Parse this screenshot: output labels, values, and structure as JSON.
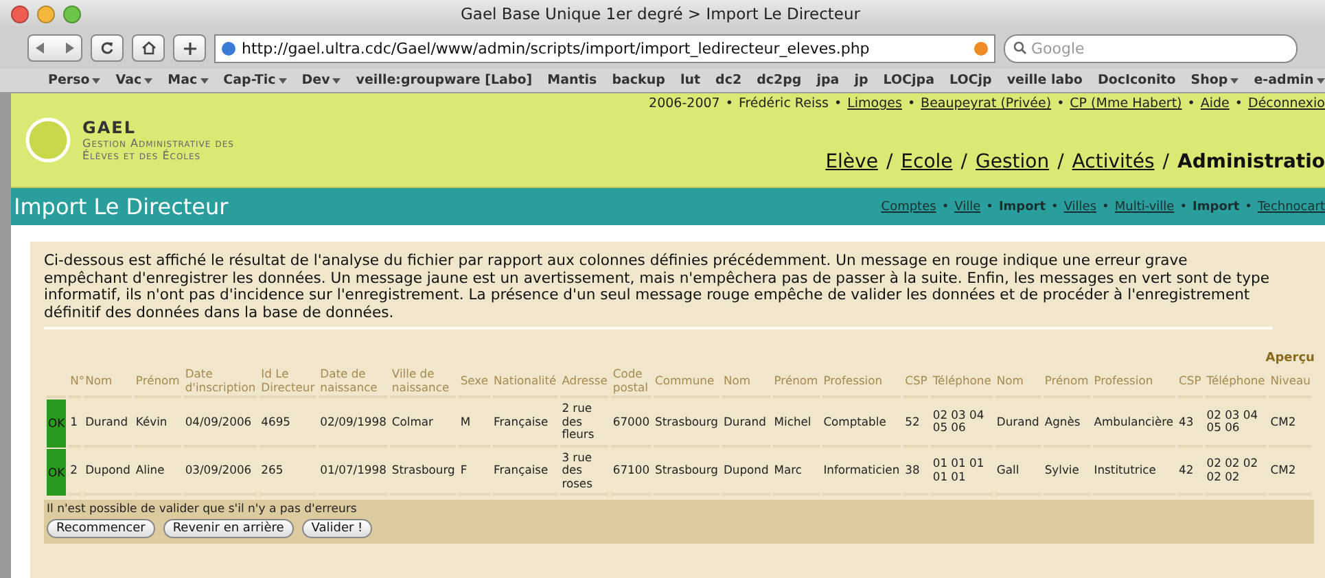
{
  "window": {
    "title": "Gael Base Unique 1er degré > Import Le Directeur"
  },
  "toolbar": {
    "url": "http://gael.ultra.cdc/Gael/www/admin/scripts/import/import_ledirecteur_eleves.php",
    "search_placeholder": "Google"
  },
  "bookmarks": [
    {
      "label": "Perso",
      "menu": true
    },
    {
      "label": "Vac",
      "menu": true
    },
    {
      "label": "Mac",
      "menu": true
    },
    {
      "label": "Cap-Tic",
      "menu": true
    },
    {
      "label": "Dev",
      "menu": true
    },
    {
      "label": "veille:groupware [Labo]",
      "menu": false
    },
    {
      "label": "Mantis",
      "menu": false
    },
    {
      "label": "backup",
      "menu": false
    },
    {
      "label": "lut",
      "menu": false
    },
    {
      "label": "dc2",
      "menu": false
    },
    {
      "label": "dc2pg",
      "menu": false
    },
    {
      "label": "jpa",
      "menu": false
    },
    {
      "label": "jp",
      "menu": false
    },
    {
      "label": "LOCjpa",
      "menu": false
    },
    {
      "label": "LOCjp",
      "menu": false
    },
    {
      "label": "veille labo",
      "menu": false
    },
    {
      "label": "DocIconito",
      "menu": false
    },
    {
      "label": "Shop",
      "menu": true
    },
    {
      "label": "e-admin",
      "menu": true
    }
  ],
  "header": {
    "logo_title": "GAEL",
    "logo_subtitle_1": "Gestion Administrative des",
    "logo_subtitle_2": "Élèves et des Écoles",
    "top_links": [
      {
        "label": "2006-2007",
        "kind": "text"
      },
      {
        "label": "•",
        "kind": "sep"
      },
      {
        "label": "Frédéric Reiss",
        "kind": "text"
      },
      {
        "label": "•",
        "kind": "sep"
      },
      {
        "label": "Limoges",
        "kind": "link"
      },
      {
        "label": "•",
        "kind": "sep"
      },
      {
        "label": "Beaupeyrat (Privée)",
        "kind": "link"
      },
      {
        "label": "•",
        "kind": "sep"
      },
      {
        "label": "CP (Mme Habert)",
        "kind": "link"
      },
      {
        "label": "•",
        "kind": "sep"
      },
      {
        "label": "Aide",
        "kind": "link"
      },
      {
        "label": "•",
        "kind": "sep"
      },
      {
        "label": "Déconnexio",
        "kind": "link"
      }
    ],
    "nav": [
      {
        "label": "Elève",
        "kind": "link"
      },
      {
        "label": "/",
        "kind": "sep"
      },
      {
        "label": "Ecole",
        "kind": "link"
      },
      {
        "label": "/",
        "kind": "sep"
      },
      {
        "label": "Gestion",
        "kind": "link"
      },
      {
        "label": "/",
        "kind": "sep"
      },
      {
        "label": "Activités",
        "kind": "link"
      },
      {
        "label": "/",
        "kind": "sep"
      },
      {
        "label": "Administratio",
        "kind": "current"
      }
    ]
  },
  "section": {
    "title": "Import Le Directeur",
    "links": [
      {
        "label": "Comptes",
        "kind": "link"
      },
      {
        "label": "•",
        "kind": "sep"
      },
      {
        "label": "Ville",
        "kind": "link"
      },
      {
        "label": "•",
        "kind": "sep"
      },
      {
        "label": "Import",
        "kind": "current"
      },
      {
        "label": "•",
        "kind": "sep"
      },
      {
        "label": "Villes",
        "kind": "link"
      },
      {
        "label": "•",
        "kind": "sep"
      },
      {
        "label": "Multi-ville",
        "kind": "link"
      },
      {
        "label": "•",
        "kind": "sep"
      },
      {
        "label": "Import",
        "kind": "current"
      },
      {
        "label": "•",
        "kind": "sep"
      },
      {
        "label": "Technocart",
        "kind": "link"
      }
    ]
  },
  "intro": "Ci-dessous est affiché le résultat de l'analyse du fichier par rapport aux colonnes définies précédemment. Un message en rouge indique une erreur grave empêchant d'enregistrer les données. Un message jaune est un avertissement, mais n'empêchera pas de passer à la suite. Enfin, les messages en vert sont de type informatif, ils n'ont pas d'incidence sur l'enregistrement. La présence d'un seul message rouge empêche de valider les données et de procéder à l'enregistrement définitif des données dans la base de données.",
  "table": {
    "caption": "Aperçu",
    "columns": [
      "N°",
      "Nom",
      "Prénom",
      "Date d'inscription",
      "Id Le Directeur",
      "Date de naissance",
      "Ville de naissance",
      "Sexe",
      "Nationalité",
      "Adresse",
      "Code postal",
      "Commune",
      "Nom",
      "Prénom",
      "Profession",
      "CSP",
      "Téléphone",
      "Nom",
      "Prénom",
      "Profession",
      "CSP",
      "Téléphone",
      "Niveau"
    ],
    "rows": [
      {
        "status": {
          "label": "OK",
          "kind": "ok",
          "color": "#2a9a1e"
        },
        "cells": [
          "1",
          "Durand",
          "Kévin",
          "04/09/2006",
          "4695",
          "02/09/1998",
          "Colmar",
          "M",
          "Française",
          "2 rue des fleurs",
          "67000",
          "Strasbourg",
          "Durand",
          "Michel",
          "Comptable",
          "52",
          "02 03 04 05 06",
          "Durand",
          "Agnès",
          "Ambulancière",
          "43",
          "02 03 04 05 06",
          "CM2"
        ]
      },
      {
        "status": {
          "label": "OK",
          "kind": "ok",
          "color": "#2a9a1e"
        },
        "cells": [
          "2",
          "Dupond",
          "Aline",
          "03/09/2006",
          "265",
          "01/07/1998",
          "Strasbourg",
          "F",
          "Française",
          "3 rue des roses",
          "67100",
          "Strasbourg",
          "Dupond",
          "Marc",
          "Informaticien",
          "38",
          "01 01 01 01 01",
          "Gall",
          "Sylvie",
          "Institutrice",
          "42",
          "02 02 02 02 02",
          "CM2"
        ]
      }
    ]
  },
  "footer": {
    "note": "Il n'est possible de valider que s'il n'y a pas d'erreurs",
    "buttons": [
      "Recommencer",
      "Revenir en arrière",
      "Valider !"
    ]
  }
}
